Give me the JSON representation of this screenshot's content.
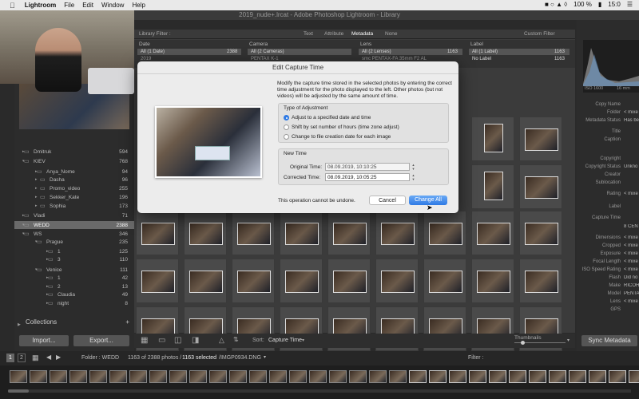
{
  "menubar": {
    "apple": "",
    "app": "Lightroom",
    "items": [
      "File",
      "Edit",
      "Window",
      "Help"
    ],
    "battery": "100 %",
    "flag": "",
    "user": "15:0"
  },
  "window_title": "2019_nude+.lrcat - Adobe Photoshop Lightroom - Library",
  "library_filter": {
    "label": "Library Filter :",
    "tabs": [
      "Text",
      "Attribute",
      "Metadata",
      "None"
    ],
    "custom": "Custom Filter",
    "columns": [
      {
        "header": "Date",
        "row": "All (1 Date)",
        "count": "2388",
        "row2": "2019"
      },
      {
        "header": "Camera",
        "row": "All (2 Cameras)",
        "count": "",
        "row2": "PENTAX K-1"
      },
      {
        "header": "Lens",
        "row": "All (2 Lenses)",
        "count": "1163",
        "row2": "smc PENTAX-FA 35mm F2 AL"
      },
      {
        "header": "Label",
        "row": "All (1 Label)",
        "count": "1163",
        "row2": "No Label",
        "count2": "1163"
      }
    ]
  },
  "folders": [
    {
      "name": "Dmitruk",
      "count": "594"
    },
    {
      "name": "KIEV",
      "count": "768"
    },
    {
      "name": "Anya_Nome",
      "count": "94"
    },
    {
      "name": "Dasha",
      "count": "96"
    },
    {
      "name": "Promo_video",
      "count": "255"
    },
    {
      "name": "Sekker_Kate",
      "count": "196"
    },
    {
      "name": "Sophia",
      "count": "173"
    },
    {
      "name": "Vladi",
      "count": "71"
    },
    {
      "name": "WEDD",
      "count": "2388"
    },
    {
      "name": "WS",
      "count": "346"
    },
    {
      "name": "Prague",
      "count": "235"
    },
    {
      "name": "1",
      "count": "125"
    },
    {
      "name": "3",
      "count": "110"
    },
    {
      "name": "Venice",
      "count": "111"
    },
    {
      "name": "1",
      "count": "42"
    },
    {
      "name": "2",
      "count": "13"
    },
    {
      "name": "Claudia",
      "count": "49"
    },
    {
      "name": "night",
      "count": "8"
    }
  ],
  "collections_label": "Collections",
  "import_label": "Import...",
  "export_label": "Export...",
  "toolbar": {
    "sort_label": "Sort:",
    "sort_value": "Capture Time",
    "thumbnails_label": "Thumbnails"
  },
  "sync_metadata": "Sync Metadata",
  "filmbar": {
    "page1": "1",
    "page2": "2",
    "folder": "Folder : WEDD",
    "photos": "1163 of 2388 photos /",
    "selected": "1163 selected",
    "file": "/IMGP0934.DNG",
    "filter": "Filter :"
  },
  "right_panel": {
    "iso": "ISO 1600",
    "focal": "16 mm",
    "fields": [
      {
        "label": "Copy Name",
        "value": ""
      },
      {
        "label": "Folder",
        "value": "< mixe"
      },
      {
        "label": "Metadata Status",
        "value": "Has be"
      },
      {
        "label": "Title",
        "value": ""
      },
      {
        "label": "Caption",
        "value": ""
      },
      {
        "label": "Copyright",
        "value": ""
      },
      {
        "label": "Copyright Status",
        "value": "Unkno"
      },
      {
        "label": "Creator",
        "value": ""
      },
      {
        "label": "Sublocation",
        "value": ""
      },
      {
        "label": "Rating",
        "value": "< mixe"
      },
      {
        "label": "Label",
        "value": ""
      },
      {
        "label": "Capture Time",
        "value": ""
      },
      {
        "label": "",
        "value": "8 CENT"
      },
      {
        "label": "Dimensions",
        "value": "< mixe"
      },
      {
        "label": "Cropped",
        "value": "< mixe"
      },
      {
        "label": "Exposure",
        "value": "< mixe"
      },
      {
        "label": "Focal Length",
        "value": "< mixe"
      },
      {
        "label": "ISO Speed Rating",
        "value": "< mixe"
      },
      {
        "label": "Flash",
        "value": "Did no"
      },
      {
        "label": "Make",
        "value": "RICOH"
      },
      {
        "label": "Model",
        "value": "PENTA"
      },
      {
        "label": "Lens",
        "value": "< mixe"
      },
      {
        "label": "GPS",
        "value": ""
      }
    ]
  },
  "dialog": {
    "title": "Edit Capture Time",
    "description": "Modify the capture time stored in the selected photos by entering the correct time adjustment for the photo displayed to the left. Other photos (but not videos) will be adjusted by the same amount of time.",
    "type_group": "Type of Adjustment",
    "options": [
      {
        "label": "Adjust to a specified date and time",
        "selected": true
      },
      {
        "label": "Shift by set number of hours (time zone adjust)",
        "selected": false
      },
      {
        "label": "Change to file creation date for each image",
        "selected": false
      }
    ],
    "new_time_group": "New Time",
    "original_label": "Original Time:",
    "original_value": "08.09.2019, 10:10:25",
    "corrected_label": "Corrected Time:",
    "corrected_value": "08.09.2019, 10:05:25",
    "warning": "This operation cannot be undone.",
    "cancel": "Cancel",
    "change_all": "Change All"
  }
}
